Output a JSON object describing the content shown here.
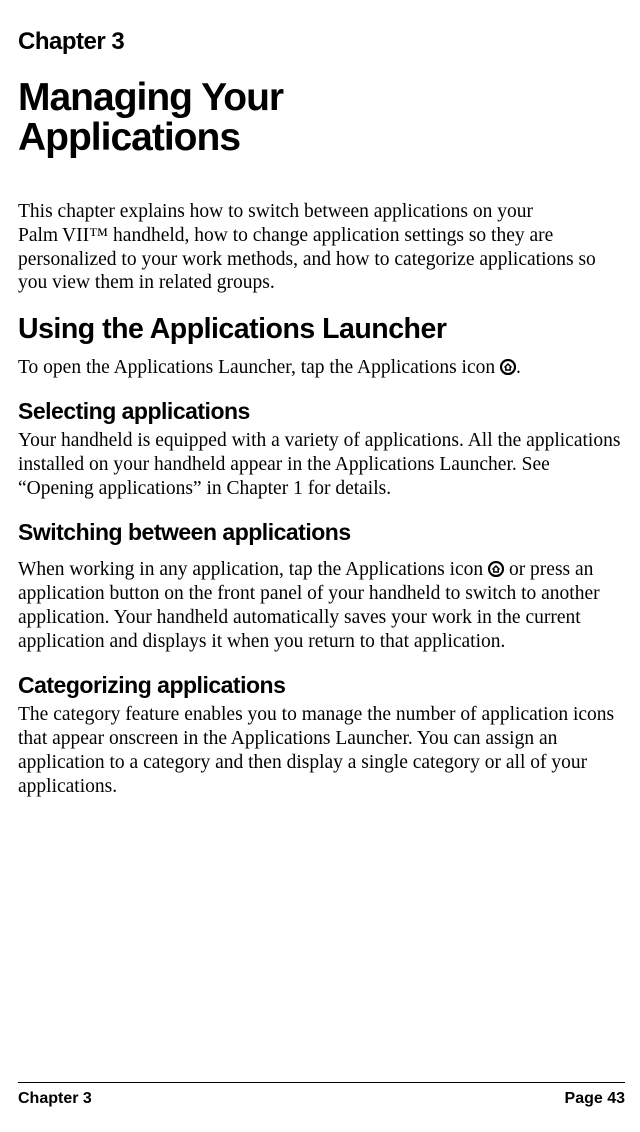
{
  "chapterLabel": "Chapter 3",
  "chapterTitleLine1": "Managing Your",
  "chapterTitleLine2": "Applications",
  "intro": "This chapter explains how to switch between applications on your Palm VII™ handheld, how to change application settings so they are personalized to your work methods, and how to categorize applications so you view them in related groups.",
  "section1Heading": "Using the Applications Launcher",
  "section1Text1a": "To open the Applications Launcher, tap the Applications icon ",
  "section1Text1b": ".",
  "sub1Heading": "Selecting applications",
  "sub1Text": "Your handheld is equipped with a variety of applications. All the applications installed on your handheld appear in the Applications Launcher. See “Opening applications” in Chapter 1 for details.",
  "sub2Heading": "Switching between applications",
  "sub2Text1a": "When working in any application, tap the Applications icon ",
  "sub2Text1b": " or press an application button on the front panel of your handheld to switch to another application. Your handheld automatically saves your work in the current application and displays it when you return to that application.",
  "sub3Heading": "Categorizing applications",
  "sub3Text": "The category feature enables you to manage the number of application icons that appear onscreen in the Applications Launcher. You can assign an application to a category and then display a single category or all of your applications.",
  "footerLeft": "Chapter 3",
  "footerRight": "Page 43"
}
